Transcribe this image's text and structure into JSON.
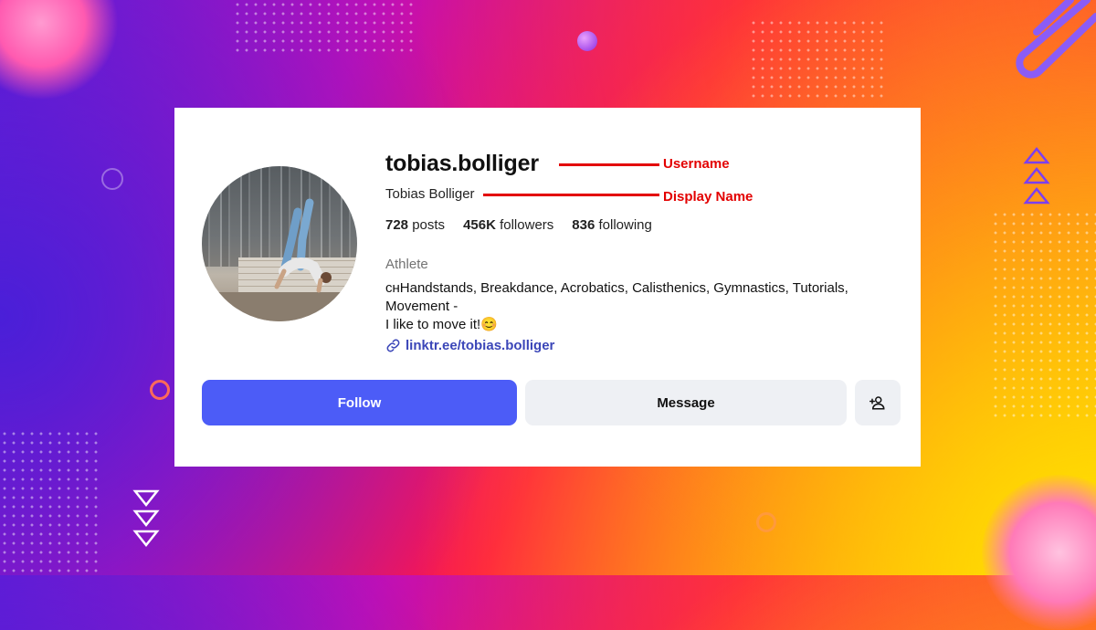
{
  "profile": {
    "username": "tobias.bolliger",
    "display_name": "Tobias Bolliger",
    "stats": {
      "posts_count": "728",
      "posts_label": "posts",
      "followers_count": "456K",
      "followers_label": "followers",
      "following_count": "836",
      "following_label": "following"
    },
    "category": "Athlete",
    "bio_line1": "ᴄʜHandstands, Breakdance, Acrobatics, Calisthenics, Gymnastics, Tutorials,",
    "bio_line2": "Movement -",
    "bio_line3": "I like to move it!😊",
    "link": "linktr.ee/tobias.bolliger"
  },
  "actions": {
    "follow_label": "Follow",
    "message_label": "Message",
    "add_user_icon": "person-plus-icon"
  },
  "annotations": {
    "username_label": "Username",
    "display_name_label": "Display Name",
    "color": "#e30000"
  },
  "colors": {
    "follow_button": "#4c5cf7",
    "secondary_button": "#eef0f4",
    "link": "#3b46b8"
  }
}
